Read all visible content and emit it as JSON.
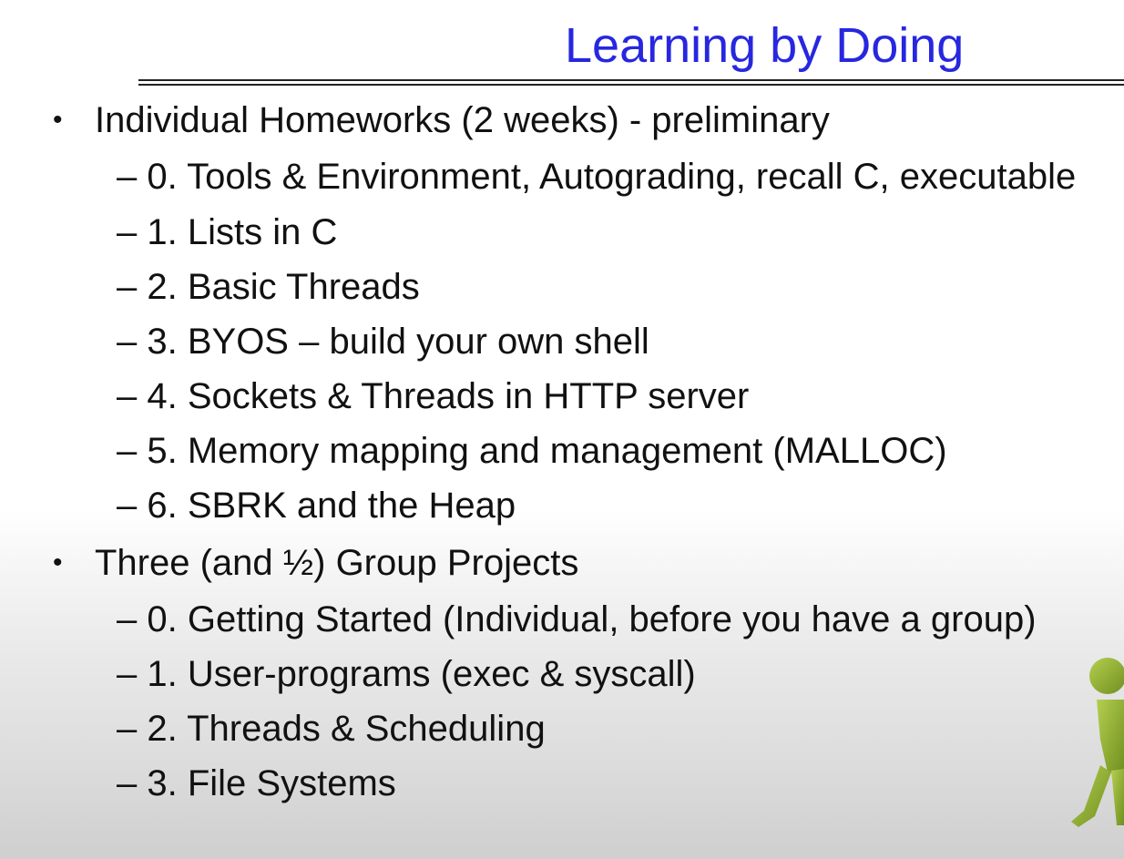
{
  "slide": {
    "title": "Learning by Doing",
    "bullet_glyph": "•",
    "sections": [
      {
        "heading": "Individual Homeworks (2 weeks) - preliminary",
        "items": [
          "– 0. Tools & Environment, Autograding, recall C, executable",
          "– 1. Lists in C",
          "– 2. Basic Threads",
          "– 3. BYOS – build your own shell",
          "– 4. Sockets & Threads in HTTP server",
          "– 5. Memory mapping and management (MALLOC)",
          "– 6. SBRK and the Heap"
        ]
      },
      {
        "heading": "Three (and ½) Group Projects",
        "items": [
          "– 0. Getting Started (Individual, before you have a group)",
          "– 1. User-programs (exec & syscall)",
          "– 2. Threads & Scheduling",
          "– 3. File Systems"
        ]
      }
    ]
  },
  "colors": {
    "title": "#2727e0",
    "text": "#111111",
    "figure": "#8fae2e"
  },
  "decoration": {
    "figure_icon": "walking-figure-icon"
  }
}
